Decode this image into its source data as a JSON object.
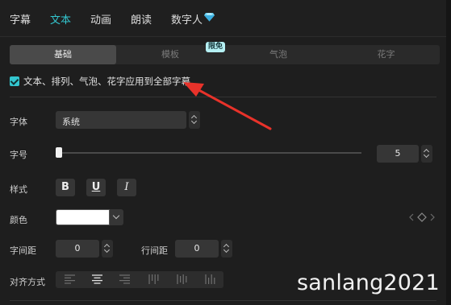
{
  "tabs": [
    {
      "label": "字幕",
      "active": false
    },
    {
      "label": "文本",
      "active": true
    },
    {
      "label": "动画",
      "active": false
    },
    {
      "label": "朗读",
      "active": false
    },
    {
      "label": "数字人",
      "active": false,
      "icon": "diamond-icon"
    }
  ],
  "subtabs": [
    {
      "label": "基础",
      "active": true
    },
    {
      "label": "模板",
      "active": false
    },
    {
      "label": "气泡",
      "active": false
    },
    {
      "label": "花字",
      "active": false
    }
  ],
  "subtab_badge": "限免",
  "apply_all": {
    "label": "文本、排列、气泡、花字应用到全部字幕",
    "checked": true
  },
  "font": {
    "label": "字体",
    "value": "系统"
  },
  "size": {
    "label": "字号",
    "value": "5",
    "slider_fraction": 0.0
  },
  "style": {
    "label": "样式",
    "bold": "B",
    "underline": "U",
    "italic": "I"
  },
  "color": {
    "label": "颜色",
    "value": "#ffffff"
  },
  "letter_spacing": {
    "label": "字间距",
    "value": "0"
  },
  "line_spacing": {
    "label": "行间距",
    "value": "0"
  },
  "alignment": {
    "label": "对齐方式",
    "options": [
      "align-left",
      "align-center",
      "align-right",
      "vertical-top",
      "vertical-center",
      "vertical-bottom"
    ],
    "selected": "align-center"
  },
  "watermark": "sanlang2021",
  "colors": {
    "accent": "#33c6cf",
    "arrow": "#e8322a",
    "background": "#1e1e1e"
  }
}
